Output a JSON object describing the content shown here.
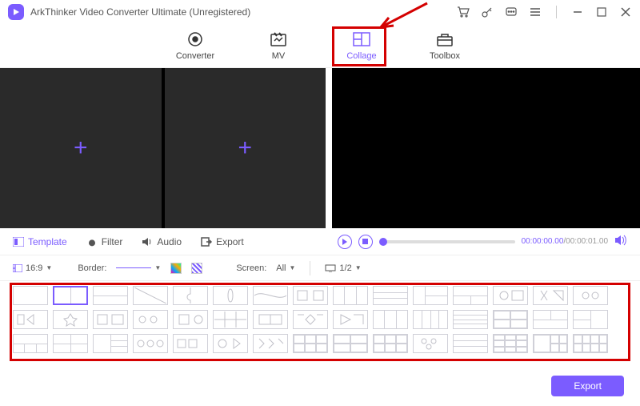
{
  "titlebar": {
    "title": "ArkThinker Video Converter Ultimate (Unregistered)"
  },
  "tabs": {
    "converter": "Converter",
    "mv": "MV",
    "collage": "Collage",
    "toolbox": "Toolbox"
  },
  "subtabs": {
    "template": "Template",
    "filter": "Filter",
    "audio": "Audio",
    "export": "Export"
  },
  "playback": {
    "current": "00:00:00.00",
    "total": "00:00:01.00"
  },
  "options": {
    "ratio": "16:9",
    "border_label": "Border:",
    "screen_label": "Screen:",
    "screen_value": "All",
    "view_value": "1/2"
  },
  "footer": {
    "export": "Export"
  }
}
